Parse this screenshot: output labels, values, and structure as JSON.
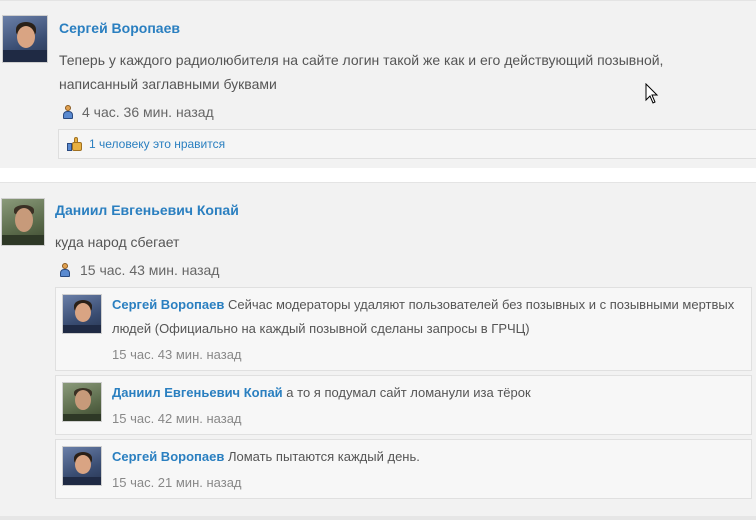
{
  "post1": {
    "author": "Сергей Воропаев",
    "text": "Теперь у каждого радиолюбителя на сайте логин такой же как и его действующий позывной, написанный заглавными буквами",
    "time": "4 час. 36 мин. назад",
    "likes": "1 человеку это нравится"
  },
  "post2": {
    "author": "Даниил Евгеньевич Копай",
    "text": "куда народ сбегает",
    "time": "15 час. 43 мин. назад",
    "replies": [
      {
        "author": "Сергей Воропаев",
        "text": "Сейчас модераторы удаляют пользователей без позывных и с позывными мертвых людей (Официально на каждый позывной сделаны запросы в ГРЧЦ)",
        "time": "15 час. 43 мин. назад"
      },
      {
        "author": "Даниил Евгеньевич Копай",
        "text": "а то я подумал сайт ломанули иза тёрок",
        "time": "15 час. 42 мин. назад"
      },
      {
        "author": "Сергей Воропаев",
        "text": "Ломать пытаются каждый день.",
        "time": "15 час. 21 мин. назад"
      }
    ]
  },
  "icons": {
    "user": "user-icon",
    "like": "thumbs-up-icon",
    "cursor": "mouse-pointer-icon"
  },
  "colors": {
    "link": "#2a7fc0",
    "post_bg": "#f2f2f2",
    "reply_bg": "#f7f7f7"
  }
}
